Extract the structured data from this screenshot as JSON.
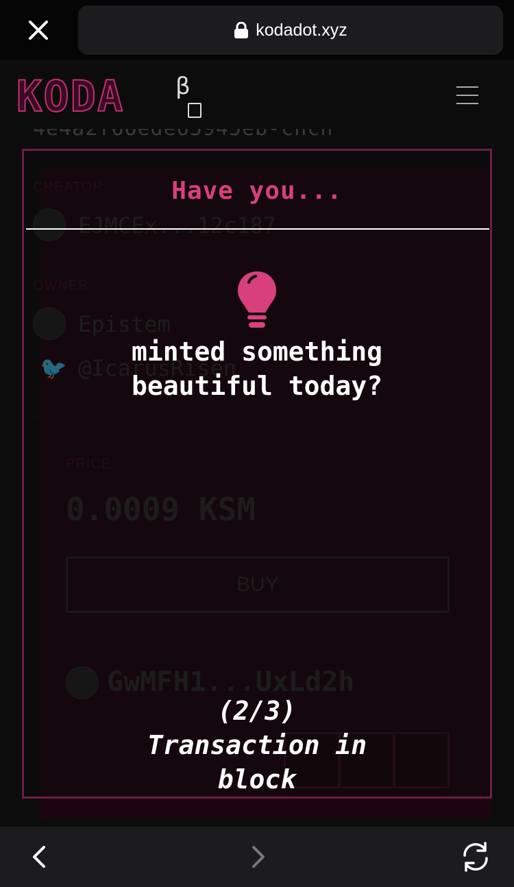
{
  "browser": {
    "url": "kodadot.xyz",
    "close_icon": "close-icon",
    "lock_icon": "lock-icon"
  },
  "site": {
    "logo_text": "KODA",
    "logo_beta": "β",
    "menu_icon": "hamburger-menu-icon"
  },
  "background_page": {
    "hash_text": "4e4a2f66ede65945eb-chch",
    "creator_label": "CREATOR",
    "creator_address": "EJMCEx...12c187",
    "owner_label": "OWNER",
    "owner_name": "Epistem",
    "owner_twitter": "@IcarusRisen",
    "price_label": "PRICE",
    "price_value": "0.0009 KSM",
    "buy_label": "BUY",
    "holder_address": "GwMFH1...UxLd2h"
  },
  "modal": {
    "title": "Have you...",
    "icon": "lightbulb-icon",
    "message": "minted something\nbeautiful today?",
    "status_line1": "(2/3)",
    "status_line2": "Transaction in",
    "status_line3": "block",
    "accent_color": "#d7407d"
  },
  "bottom_nav": {
    "back_icon": "chevron-left-icon",
    "forward_icon": "chevron-right-icon",
    "reload_icon": "reload-icon"
  }
}
